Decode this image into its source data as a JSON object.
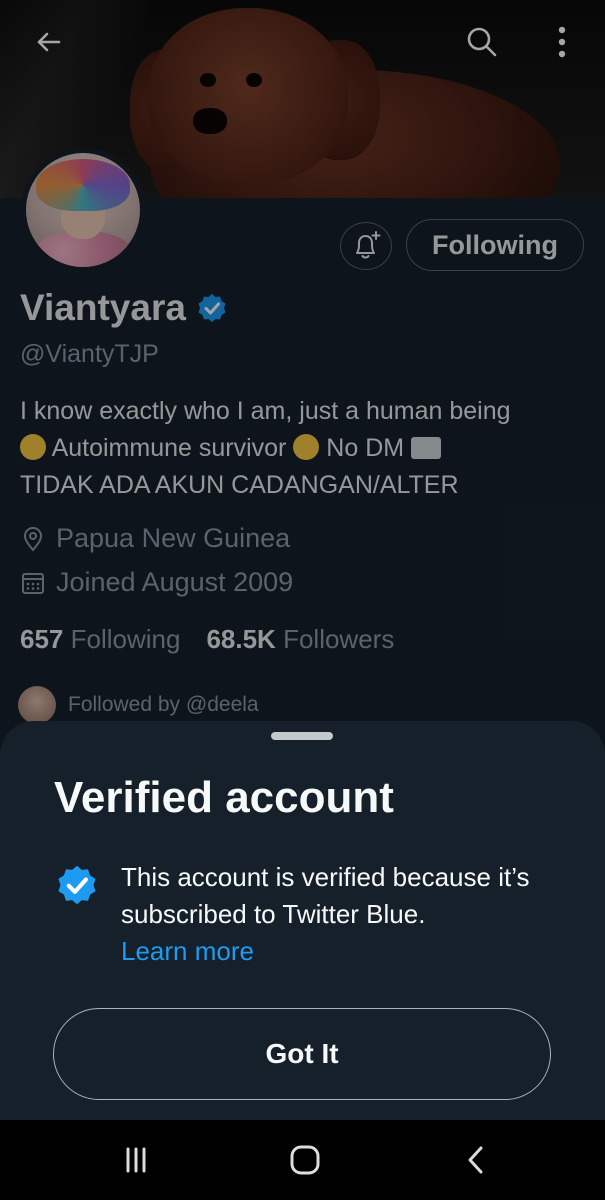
{
  "header": {
    "back_icon": "arrow-left-icon",
    "search_icon": "search-icon",
    "more_icon": "more-vertical-icon"
  },
  "profile": {
    "display_name": "Viantyara",
    "handle": "@ViantyTJP",
    "bio_line1": "I know exactly who I am, just a human being",
    "bio_line2_a": "Autoimmune survivor",
    "bio_line2_b": "No DM",
    "bio_line3": "TIDAK ADA AKUN CADANGAN/ALTER",
    "location": "Papua New Guinea",
    "joined": "Joined August 2009",
    "following_count": "657",
    "following_label": "Following",
    "followers_count": "68.5K",
    "followers_label": "Followers",
    "followed_by": "Followed by @deela",
    "follow_button_label": "Following"
  },
  "sheet": {
    "title": "Verified account",
    "text": "This account is verified because it’s subscribed to Twitter Blue.",
    "learn_more": "Learn more",
    "got_it_label": "Got It"
  },
  "colors": {
    "background": "#15202b",
    "accent": "#1d9bf0",
    "muted": "#8b98a5"
  }
}
